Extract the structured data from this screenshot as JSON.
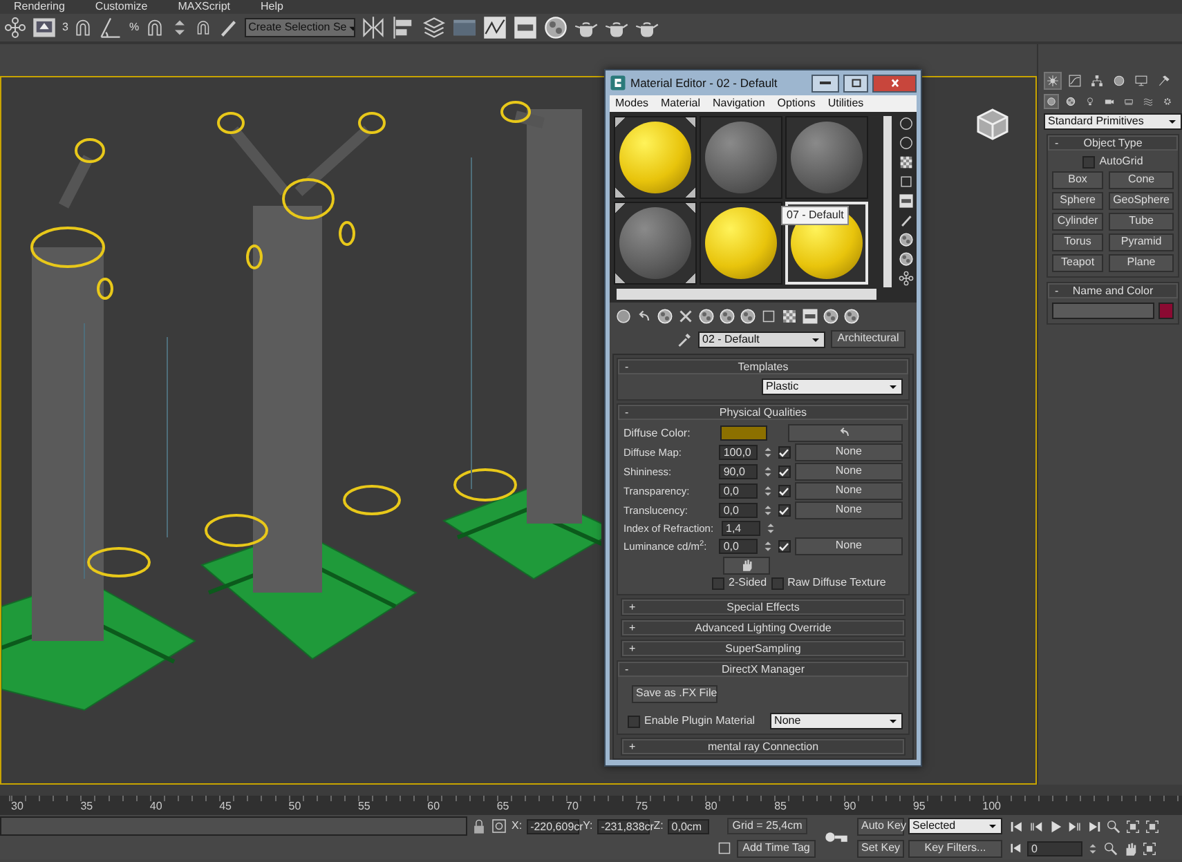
{
  "menu_bar": [
    "Rendering",
    "Customize",
    "MAXScript",
    "Help"
  ],
  "main_toolbar": {
    "snap_labels": [
      "3",
      "%"
    ],
    "selection_set": "Create Selection Se"
  },
  "material_editor": {
    "title": "Material Editor - 02 - Default",
    "menu": [
      "Modes",
      "Material",
      "Navigation",
      "Options",
      "Utilities"
    ],
    "slots": [
      {
        "kind": "yellow",
        "selected": false,
        "hot": true
      },
      {
        "kind": "gray",
        "selected": false,
        "hot": false
      },
      {
        "kind": "gray",
        "selected": false,
        "hot": false
      },
      {
        "kind": "gray",
        "selected": false,
        "hot": true
      },
      {
        "kind": "yellow",
        "selected": false,
        "hot": false
      },
      {
        "kind": "yellow",
        "selected": true,
        "hot": false
      }
    ],
    "tooltip": "07 - Default",
    "material_name": "02 - Default",
    "material_type": "Architectural",
    "rollouts": [
      {
        "kind": "templates",
        "sign": "-",
        "title": "Templates",
        "expanded": true,
        "template": "Plastic"
      },
      {
        "kind": "physical",
        "sign": "-",
        "title": "Physical Qualities",
        "expanded": true,
        "diffuse": {
          "label": "Diffuse Color:",
          "color": "#8c7000"
        },
        "params": [
          {
            "label": "Diffuse Map:",
            "value": "100,0",
            "checked": true,
            "map": "None"
          },
          {
            "label": "Shininess:",
            "value": "90,0",
            "checked": true,
            "map": "None"
          },
          {
            "label": "Transparency:",
            "value": "0,0",
            "checked": true,
            "map": "None"
          },
          {
            "label": "Translucency:",
            "value": "0,0",
            "checked": true,
            "map": "None"
          },
          {
            "label": "Index of Refraction:",
            "value": "1,4"
          },
          {
            "label": "Luminance cd/m$^{2}$:",
            "value": "0,0",
            "checked": true,
            "map": "None"
          }
        ],
        "options": [
          {
            "label": "2-Sided",
            "checked": false
          },
          {
            "label": "Raw Diffuse Texture",
            "checked": false
          }
        ]
      },
      {
        "kind": "plain",
        "sign": "+",
        "title": "Special Effects",
        "expanded": false
      },
      {
        "kind": "plain",
        "sign": "+",
        "title": "Advanced Lighting Override",
        "expanded": false
      },
      {
        "kind": "plain",
        "sign": "+",
        "title": "SuperSampling",
        "expanded": false
      },
      {
        "kind": "directx",
        "sign": "-",
        "title": "DirectX Manager",
        "expanded": true,
        "save_button": "Save as .FX File",
        "plugin": {
          "label": "Enable Plugin Material",
          "checked": false,
          "value": "None"
        }
      },
      {
        "kind": "plain",
        "sign": "+",
        "title": "mental ray Connection",
        "expanded": false
      }
    ]
  },
  "command_panel": {
    "tabs": [
      {
        "selected": true
      },
      {
        "selected": false
      },
      {
        "selected": false
      },
      {
        "selected": false
      },
      {
        "selected": false
      },
      {
        "selected": false
      }
    ],
    "categories": [
      {
        "selected": true
      },
      {
        "selected": false
      },
      {
        "selected": false
      },
      {
        "selected": false
      },
      {
        "selected": false
      },
      {
        "selected": false
      },
      {
        "selected": false
      }
    ],
    "dropdown": "Standard Primitives",
    "object_type": {
      "sign": "-",
      "title": "Object Type",
      "autogrid": {
        "label": "AutoGrid",
        "checked": false
      },
      "buttons": [
        "Box",
        "Cone",
        "Sphere",
        "GeoSphere",
        "Cylinder",
        "Tube",
        "Torus",
        "Pyramid",
        "Teapot",
        "Plane"
      ]
    },
    "name_and_color": {
      "sign": "-",
      "title": "Name and Color",
      "color": "#8b0a32"
    }
  },
  "timeline": {
    "ticks": [
      "30",
      "35",
      "40",
      "45",
      "50",
      "55",
      "60",
      "65",
      "70",
      "75",
      "80",
      "85",
      "90",
      "95",
      "100"
    ]
  },
  "status_bar": {
    "coords": [
      {
        "label": "X:",
        "value": "-220,609cr"
      },
      {
        "label": "Y:",
        "value": "-231,838cr"
      },
      {
        "label": "Z:",
        "value": "0,0cm"
      }
    ],
    "grid": "Grid = 25,4cm",
    "time_tag": "Add Time Tag",
    "auto_key": "Auto Key",
    "set_key": "Set Key",
    "key_mode": "Selected",
    "key_filters": "Key Filters...",
    "frame": "0"
  }
}
